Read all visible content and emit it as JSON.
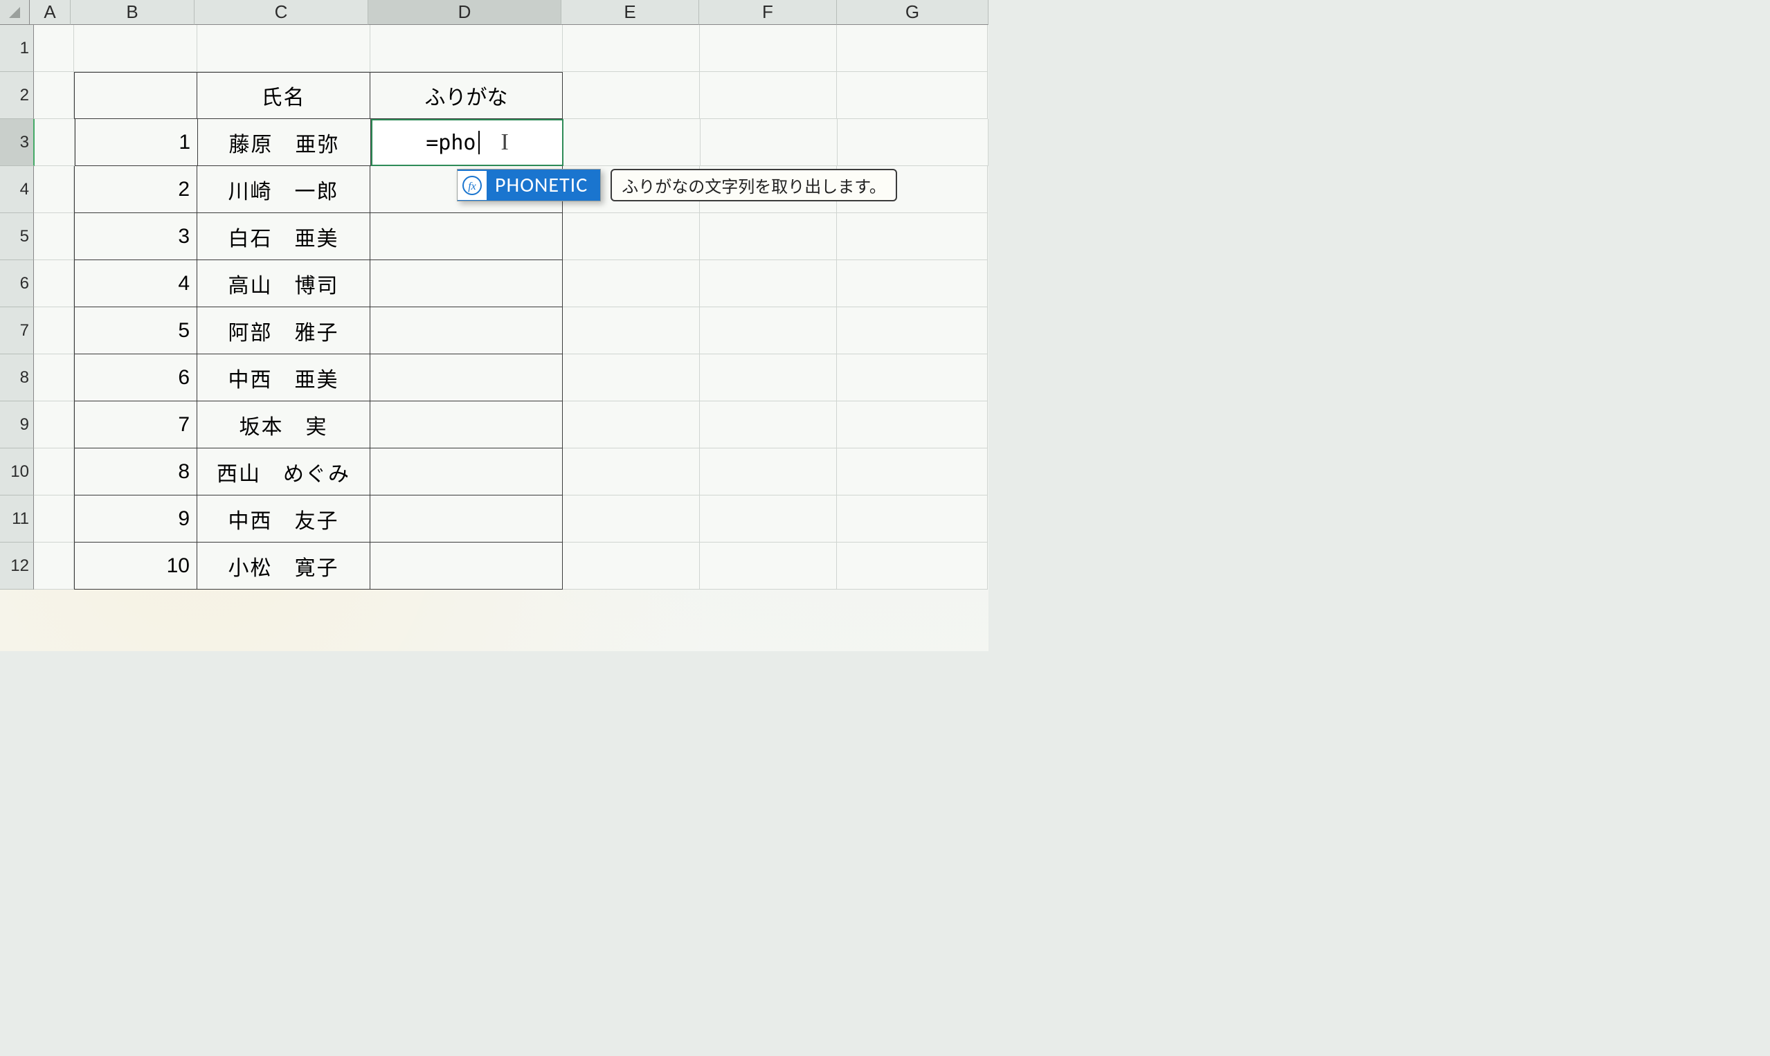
{
  "columns": [
    "A",
    "B",
    "C",
    "D",
    "E",
    "F",
    "G"
  ],
  "active_column": "D",
  "active_row": "3",
  "headers": {
    "name": "氏名",
    "furigana": "ふりがな"
  },
  "rows": [
    {
      "n": "1",
      "name": "藤原　亜弥"
    },
    {
      "n": "2",
      "name": "川崎　一郎"
    },
    {
      "n": "3",
      "name": "白石　亜美"
    },
    {
      "n": "4",
      "name": "高山　博司"
    },
    {
      "n": "5",
      "name": "阿部　雅子"
    },
    {
      "n": "6",
      "name": "中西　亜美"
    },
    {
      "n": "7",
      "name": "坂本　実"
    },
    {
      "n": "8",
      "name": "西山　めぐみ"
    },
    {
      "n": "9",
      "name": "中西　友子"
    },
    {
      "n": "10",
      "name": "小松　寛子"
    }
  ],
  "editing_cell": {
    "address": "D3",
    "text": "=pho"
  },
  "autocomplete": {
    "suggestion": "PHONETIC",
    "description": "ふりがなの文字列を取り出します。"
  },
  "visible_row_numbers": [
    "1",
    "2",
    "3",
    "4",
    "5",
    "6",
    "7",
    "8",
    "9",
    "10",
    "11",
    "12"
  ]
}
